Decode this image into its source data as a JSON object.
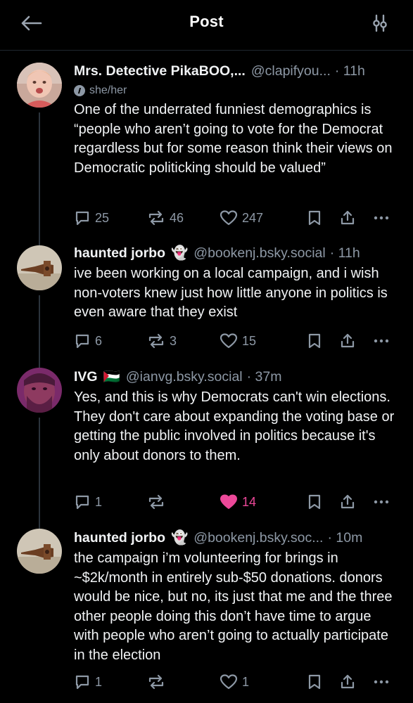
{
  "header": {
    "title": "Post"
  },
  "posts": [
    {
      "author": "Mrs. Detective PikaBOO,...",
      "emoji": "",
      "handle": "@clapifyou...",
      "time": "· 11h",
      "pronouns": "she/her",
      "text": "One of the underrated funniest demographics is “people who aren’t going to vote for the Democrat regardless but for some reason think their views on Democratic politicking should be valued”",
      "replies": "25",
      "reposts": "46",
      "likes": "247",
      "liked": false
    },
    {
      "author": "haunted jorbo",
      "emoji": "👻",
      "handle": "@bookenj.bsky.social",
      "time": "· 11h",
      "text": "ive been working on a local campaign, and i wish non-voters knew just how little anyone in politics is even aware that they exist",
      "replies": "6",
      "reposts": "3",
      "likes": "15",
      "liked": false
    },
    {
      "author": "IVG",
      "emoji": "🇵🇸",
      "handle": "@ianvg.bsky.social",
      "time": "· 37m",
      "text": "Yes, and this is why Democrats can't win elections. They don't care about expanding the voting base or getting the public involved in politics because it's only about donors to them.",
      "replies": "1",
      "reposts": "",
      "likes": "14",
      "liked": true
    },
    {
      "author": "haunted jorbo",
      "emoji": "👻",
      "handle": "@bookenj.bsky.soc...",
      "time": "· 10m",
      "text": "the campaign i’m volunteering for brings in ~$2k/month in entirely sub-$50 donations. donors would be nice, but no, its just that me and the three other people doing this don’t have time to argue with people who aren’t going to actually participate in the election",
      "replies": "1",
      "reposts": "",
      "likes": "1",
      "liked": false
    }
  ]
}
